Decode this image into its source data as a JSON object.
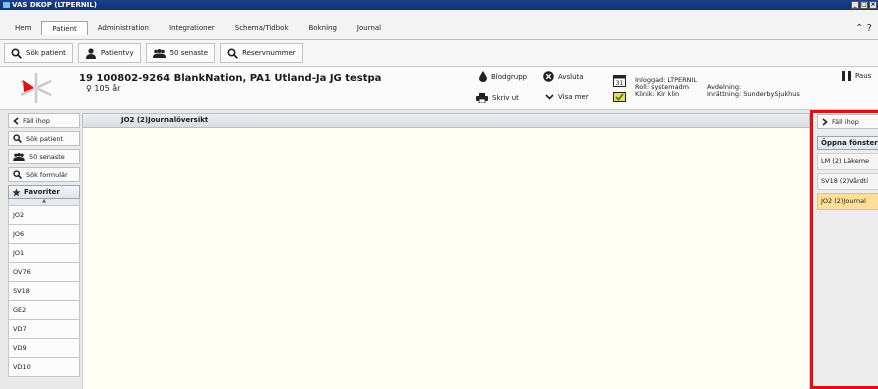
{
  "window": {
    "title": "VAS DKOP (LTPERNIL)"
  },
  "tabs": [
    "Hem",
    "Patient",
    "Administration",
    "Integrationer",
    "Schema/Tidbok",
    "Bokning",
    "Journal"
  ],
  "toolbar": {
    "search_patient": "Sök patient",
    "patient_view": "Patientvy",
    "latest_50": "50 senaste",
    "reserve_number": "Reservnummer"
  },
  "patient": {
    "name": "19 100802-9264 BlankNation, PA1 Utland-Ja JG testpa",
    "age": "♀ 105 år"
  },
  "actions": {
    "blood_group": "Blodgrupp",
    "close": "Avsluta",
    "print": "Skriv ut",
    "show_more": "Visa mer",
    "pause": "Paus"
  },
  "login": {
    "logged_in": "Inloggad: LTPERNIL",
    "role": "Roll:  systemadm",
    "clinic": "Klinik: Kir klin",
    "department": "Avdelning:",
    "facility": "Inrättning: SunderbySjukhus"
  },
  "left_panel": {
    "collapse": "Fäll ihop",
    "search_patient": "Sök patient",
    "latest_50": "50 senaste",
    "search_form": "Sök formulär",
    "favorites": "Favoriter",
    "items": [
      "JO2",
      "JO6",
      "JO1",
      "OV76",
      "SV18",
      "GE2",
      "VD7",
      "VD9",
      "VD10"
    ]
  },
  "content": {
    "title": "JO2 (2)Journalöversikt"
  },
  "right_panel": {
    "collapse": "Fäll ihop",
    "open_windows": "Öppna fönster",
    "windows": [
      "LM (2) Läkeme",
      "SV18 (2)Vårdti",
      "JO2 (2)Journal"
    ],
    "active_index": 2
  },
  "colors": {
    "highlight_border": "#e01010",
    "active_window": "#fddf9a",
    "title_bar": "#1c3f8c"
  }
}
